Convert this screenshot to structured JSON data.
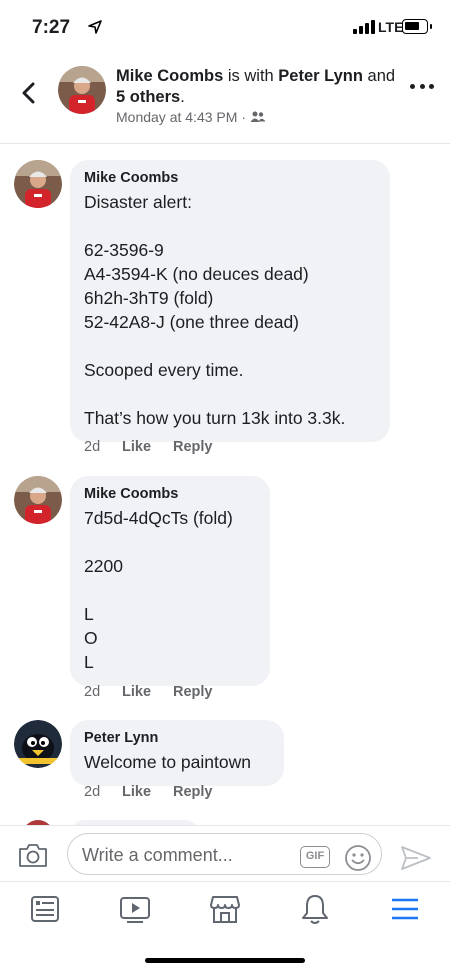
{
  "status_bar": {
    "time": "7:27",
    "network": "LTE"
  },
  "header": {
    "author": "Mike Coombs",
    "with_text": " is with ",
    "tagged": "Peter Lynn",
    "and_text": " and ",
    "others": "5 others",
    "period": ".",
    "timestamp": "Monday at 4:43 PM",
    "separator": "·"
  },
  "comments": [
    {
      "author": "Mike Coombs",
      "text": "Disaster alert:\n\n62-3596-9\nA4-3594-K (no deuces dead)\n6h2h-3hT9 (fold)\n52-42A8-J (one three dead)\n\nScooped every time.\n\nThat’s how you turn 13k into 3.3k.",
      "age": "2d",
      "like": "Like",
      "reply": "Reply"
    },
    {
      "author": "Mike Coombs",
      "text": "7d5d-4dQcTs (fold)\n\n2200\n\nL\nO\nL",
      "age": "2d",
      "like": "Like",
      "reply": "Reply"
    },
    {
      "author": "Peter Lynn",
      "text": "Welcome to paintown",
      "age": "2d",
      "like": "Like",
      "reply": "Reply"
    }
  ],
  "composer": {
    "placeholder": "Write a comment...",
    "gif_label": "GIF"
  },
  "tabbar": {
    "active_color": "#1877f2"
  }
}
